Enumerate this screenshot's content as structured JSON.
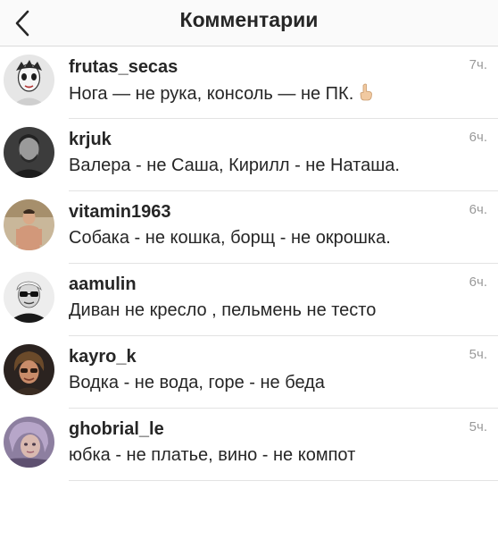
{
  "header": {
    "title": "Комментарии",
    "back_icon": "chevron-left-icon"
  },
  "comments": [
    {
      "username": "frutas_secas",
      "text": "Нога — не рука, консоль — не ПК.",
      "emoji": "hand-pointing-up",
      "time": "7ч."
    },
    {
      "username": "krjuk",
      "text": "Валера - не Саша, Кирилл - не Наташа.",
      "time": "6ч."
    },
    {
      "username": "vitamin1963",
      "text": "Собака - не кошка, борщ - не окрошка.",
      "time": "6ч."
    },
    {
      "username": "aamulin",
      "text": "Диван не кресло , пельмень не тесто",
      "time": "6ч."
    },
    {
      "username": "kayro_k",
      "text": "Водка - не вода, горе - не беда",
      "time": "5ч."
    },
    {
      "username": "ghobrial_le",
      "text": "юбка - не платье, вино - не компот",
      "time": "5ч."
    }
  ],
  "colors": {
    "text": "#262626",
    "muted": "#999999",
    "divider": "#dbdbdb"
  }
}
